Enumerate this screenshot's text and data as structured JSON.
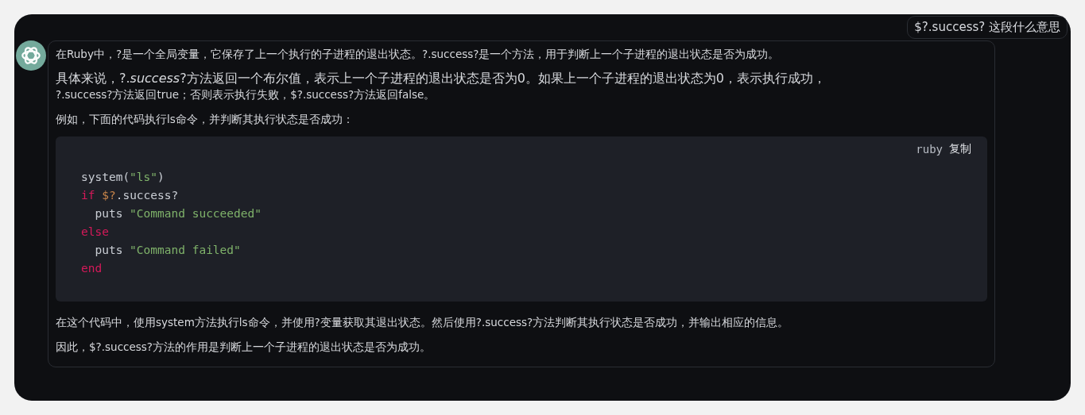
{
  "user_message": {
    "text": "$?.success? 这段什么意思"
  },
  "assistant_message": {
    "paragraphs_before": [
      "在Ruby中，?是一个全局变量，它保存了上一个执行的子进程的退出状态。?.success?是一个方法，用于判断上一个子进程的退出状态是否为成功。",
      "具体来说，?.*success*?方法返回一个布尔值，表示上一个子进程的退出状态是否为0。如果上一个子进程的退出状态为0，表示执行成功，",
      "?.success?方法返回true；否则表示执行失败，$?.success?方法返回false。",
      "例如，下面的代码执行ls命令，并判断其执行状态是否成功："
    ],
    "code_block": {
      "language": "ruby",
      "copy_label": "复制",
      "lines": [
        [
          {
            "text": "system(",
            "kind": "plain"
          },
          {
            "text": "\"ls\"",
            "kind": "string"
          },
          {
            "text": ")",
            "kind": "plain"
          }
        ],
        [
          {
            "text": "if ",
            "kind": "keyword"
          },
          {
            "text": "$?",
            "kind": "variable"
          },
          {
            "text": ".success?",
            "kind": "plain"
          }
        ],
        [
          {
            "text": "  puts ",
            "kind": "plain"
          },
          {
            "text": "\"Command succeeded\"",
            "kind": "string"
          }
        ],
        [
          {
            "text": "else",
            "kind": "keyword"
          }
        ],
        [
          {
            "text": "  puts ",
            "kind": "plain"
          },
          {
            "text": "\"Command failed\"",
            "kind": "string"
          }
        ],
        [
          {
            "text": "end",
            "kind": "keyword"
          }
        ]
      ]
    },
    "paragraphs_after": [
      "在这个代码中，使用system方法执行ls命令，并使用?变量获取其退出状态。然后使用?.success?方法判断其执行状态是否成功，并输出相应的信息。",
      "因此，$?.success?方法的作用是判断上一个子进程的退出状态是否为成功。"
    ]
  }
}
